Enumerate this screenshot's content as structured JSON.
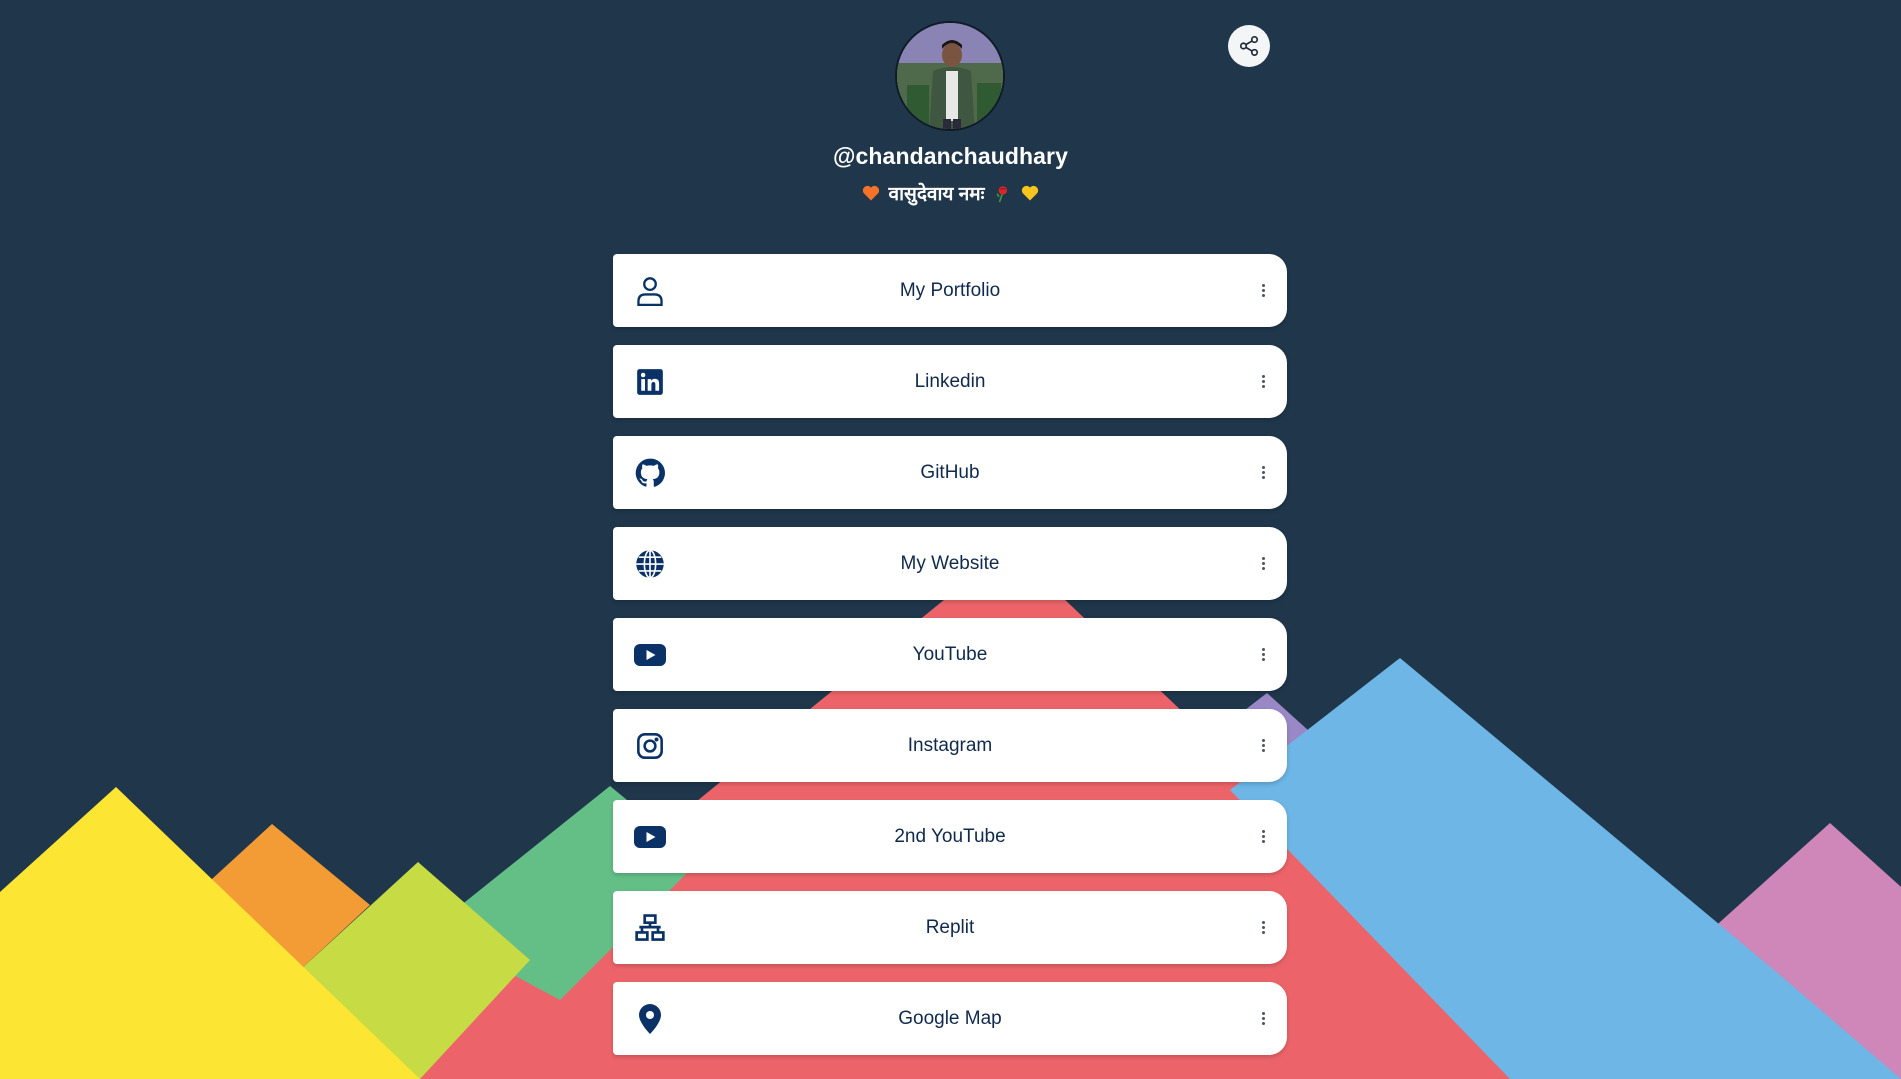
{
  "profile": {
    "username": "@chandanchaudhary",
    "bio_text": "वासुदेवाय नमः",
    "bio_emoji_left": "orange-heart-icon",
    "bio_emoji_mid": "rose-icon",
    "bio_emoji_right": "yellow-heart-icon"
  },
  "share": {
    "icon": "share-icon"
  },
  "links": [
    {
      "label": "My Portfolio",
      "icon": "user-icon"
    },
    {
      "label": "Linkedin",
      "icon": "linkedin-icon"
    },
    {
      "label": "GitHub",
      "icon": "github-icon"
    },
    {
      "label": "My Website",
      "icon": "globe-icon"
    },
    {
      "label": "YouTube",
      "icon": "youtube-icon"
    },
    {
      "label": "Instagram",
      "icon": "instagram-icon"
    },
    {
      "label": "2nd YouTube",
      "icon": "youtube-icon"
    },
    {
      "label": "Replit",
      "icon": "network-icon"
    },
    {
      "label": "Google Map",
      "icon": "map-pin-icon"
    }
  ],
  "colors": {
    "background": "#1f364b",
    "link_text": "#102a4c",
    "icon": "#0b3266",
    "card": "#ffffff"
  }
}
